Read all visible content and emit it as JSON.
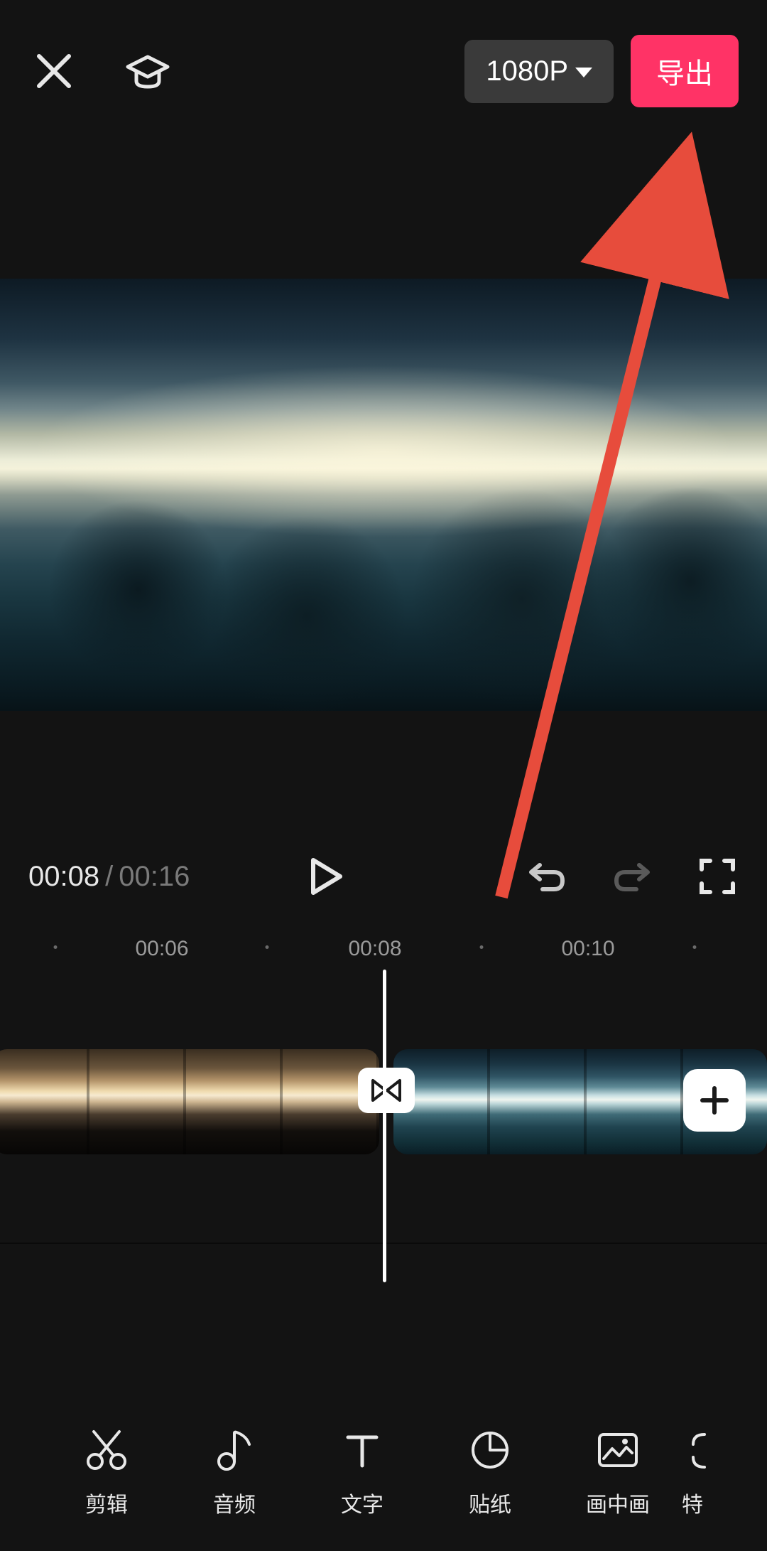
{
  "header": {
    "resolution_label": "1080P",
    "export_label": "导出"
  },
  "playback": {
    "current_time": "00:08",
    "separator": "/",
    "total_time": "00:16"
  },
  "ruler": {
    "ticks": [
      "00:06",
      "00:08",
      "00:10"
    ]
  },
  "toolbar": {
    "items": [
      {
        "label": "剪辑",
        "icon": "scissors-icon"
      },
      {
        "label": "音频",
        "icon": "music-note-icon"
      },
      {
        "label": "文字",
        "icon": "text-icon"
      },
      {
        "label": "贴纸",
        "icon": "sticker-icon"
      },
      {
        "label": "画中画",
        "icon": "picture-in-picture-icon"
      }
    ],
    "peek_label": "特"
  },
  "annotation": {
    "arrow_color": "#e74c3c"
  }
}
